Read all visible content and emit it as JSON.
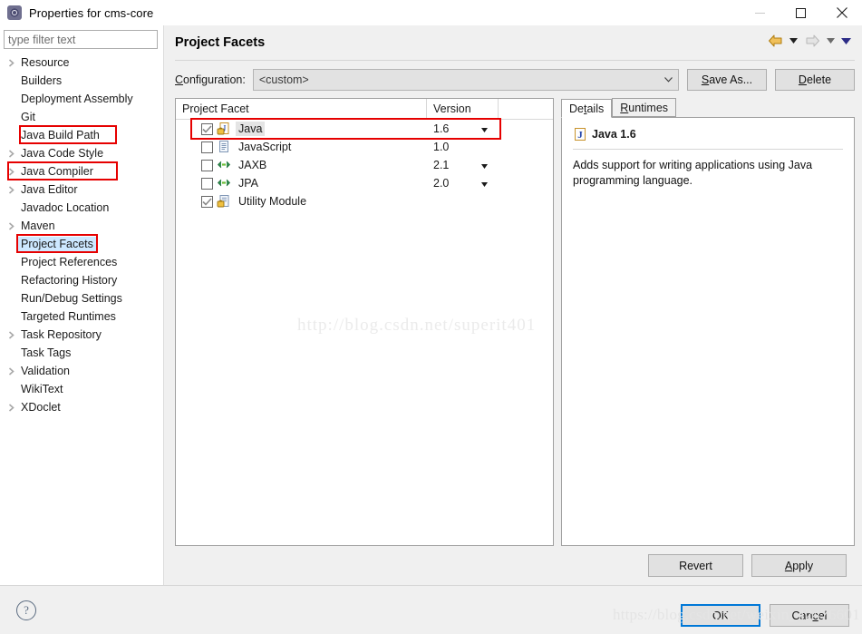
{
  "window": {
    "title": "Properties for cms-core",
    "icon": "eclipse-properties-icon",
    "controls": {
      "minimize": "minimize-icon",
      "maximize": "maximize-icon",
      "close": "close-icon"
    }
  },
  "sidebar": {
    "filter": {
      "placeholder": "type filter text",
      "value": ""
    },
    "items": [
      {
        "label": "Resource",
        "expandable": true,
        "selected": false,
        "highlighted": false
      },
      {
        "label": "Builders",
        "expandable": false,
        "selected": false,
        "highlighted": false
      },
      {
        "label": "Deployment Assembly",
        "expandable": false,
        "selected": false,
        "highlighted": false
      },
      {
        "label": "Git",
        "expandable": false,
        "selected": false,
        "highlighted": false
      },
      {
        "label": "Java Build Path",
        "expandable": false,
        "selected": false,
        "highlighted": true
      },
      {
        "label": "Java Code Style",
        "expandable": true,
        "selected": false,
        "highlighted": false
      },
      {
        "label": "Java Compiler",
        "expandable": true,
        "selected": false,
        "highlighted": true
      },
      {
        "label": "Java Editor",
        "expandable": true,
        "selected": false,
        "highlighted": false
      },
      {
        "label": "Javadoc Location",
        "expandable": false,
        "selected": false,
        "highlighted": false
      },
      {
        "label": "Maven",
        "expandable": true,
        "selected": false,
        "highlighted": false
      },
      {
        "label": "Project Facets",
        "expandable": false,
        "selected": true,
        "highlighted": true
      },
      {
        "label": "Project References",
        "expandable": false,
        "selected": false,
        "highlighted": false
      },
      {
        "label": "Refactoring History",
        "expandable": false,
        "selected": false,
        "highlighted": false
      },
      {
        "label": "Run/Debug Settings",
        "expandable": false,
        "selected": false,
        "highlighted": false
      },
      {
        "label": "Targeted Runtimes",
        "expandable": false,
        "selected": false,
        "highlighted": false
      },
      {
        "label": "Task Repository",
        "expandable": true,
        "selected": false,
        "highlighted": false
      },
      {
        "label": "Task Tags",
        "expandable": false,
        "selected": false,
        "highlighted": false
      },
      {
        "label": "Validation",
        "expandable": true,
        "selected": false,
        "highlighted": false
      },
      {
        "label": "WikiText",
        "expandable": false,
        "selected": false,
        "highlighted": false
      },
      {
        "label": "XDoclet",
        "expandable": true,
        "selected": false,
        "highlighted": false
      }
    ]
  },
  "page": {
    "title": "Project Facets",
    "nav": {
      "back_icon": "back-arrow-icon",
      "back_menu_icon": "chevron-down-icon",
      "forward_icon": "forward-arrow-icon",
      "forward_menu_icon": "chevron-down-icon",
      "view_menu_icon": "chevron-down-icon"
    }
  },
  "configuration": {
    "label": "Configuration:",
    "label_mnemonic": "C",
    "value": "<custom>",
    "dropdown_icon": "chevron-down-icon",
    "save_as_button": "Save As...",
    "save_as_mnemonic": "S",
    "delete_button": "Delete",
    "delete_mnemonic": "D"
  },
  "facet_table": {
    "columns": [
      "Project Facet",
      "Version"
    ],
    "rows": [
      {
        "name": "Java",
        "version": "1.6",
        "checked": true,
        "locked": true,
        "has_version_dropdown": true,
        "selected": true,
        "highlighted": true,
        "icon": "java-facet-icon"
      },
      {
        "name": "JavaScript",
        "version": "1.0",
        "checked": false,
        "locked": false,
        "has_version_dropdown": false,
        "selected": false,
        "highlighted": false,
        "icon": "javascript-facet-icon"
      },
      {
        "name": "JAXB",
        "version": "2.1",
        "checked": false,
        "locked": false,
        "has_version_dropdown": true,
        "selected": false,
        "highlighted": false,
        "icon": "jaxb-facet-icon"
      },
      {
        "name": "JPA",
        "version": "2.0",
        "checked": false,
        "locked": false,
        "has_version_dropdown": true,
        "selected": false,
        "highlighted": false,
        "icon": "jpa-facet-icon"
      },
      {
        "name": "Utility Module",
        "version": "",
        "checked": true,
        "locked": true,
        "has_version_dropdown": false,
        "selected": false,
        "highlighted": false,
        "icon": "utility-module-facet-icon"
      }
    ]
  },
  "details": {
    "tabs": [
      {
        "label": "Details",
        "mnemonic": "t",
        "active": true
      },
      {
        "label": "Runtimes",
        "mnemonic": "R",
        "active": false
      }
    ],
    "heading": "Java 1.6",
    "heading_icon": "java-facet-icon",
    "description": "Adds support for writing applications using Java programming language."
  },
  "actions": {
    "revert": "Revert",
    "apply": "Apply",
    "apply_mnemonic": "A",
    "ok": "OK",
    "cancel": "Cancel",
    "cancel_mnemonic": "c",
    "help_icon": "help-question-icon"
  },
  "watermarks": {
    "center": "http://blog.csdn.net/superit401",
    "bottom": "https://blog.csdn.net/weixin_42476601"
  },
  "colors": {
    "highlight_box": "#e60000",
    "selection": "#cde8ff",
    "default_button_border": "#0078d7",
    "back_arrow": "#e8b029",
    "forward_arrow": "#c9c9c9",
    "menu_caret": "#2a2a7a"
  }
}
